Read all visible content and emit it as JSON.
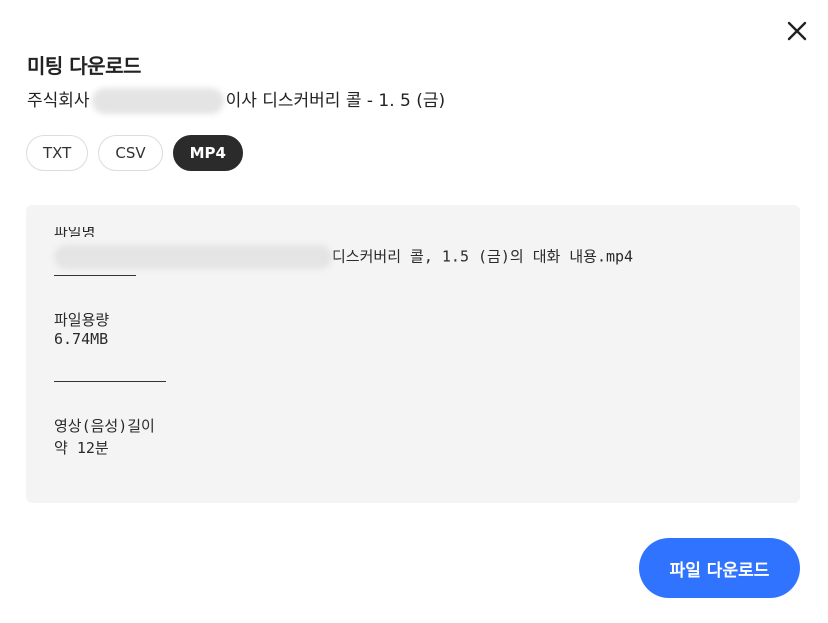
{
  "dialog": {
    "title": "미팅 다운로드",
    "subtitle_prefix": "주식회사",
    "subtitle_suffix": "이사 디스커버리 콜 - 1. 5 (금)",
    "close_icon": "close-icon"
  },
  "format_tabs": [
    {
      "label": "TXT",
      "selected": false
    },
    {
      "label": "CSV",
      "selected": false
    },
    {
      "label": "MP4",
      "selected": true
    }
  ],
  "file_info": {
    "filename_label": "파일명",
    "filename_value_suffix": "디스커버리 콜, 1.5 (금)의 대화 내용.mp4",
    "size_label": "파일용량",
    "size_value": "6.74MB",
    "duration_label": "영상(음성)길이",
    "duration_value": "약 12분"
  },
  "actions": {
    "download_label": "파일 다운로드"
  },
  "colors": {
    "primary": "#2f73ff",
    "tab_active_bg": "#2b2b2b",
    "panel_bg": "#f4f4f4"
  }
}
